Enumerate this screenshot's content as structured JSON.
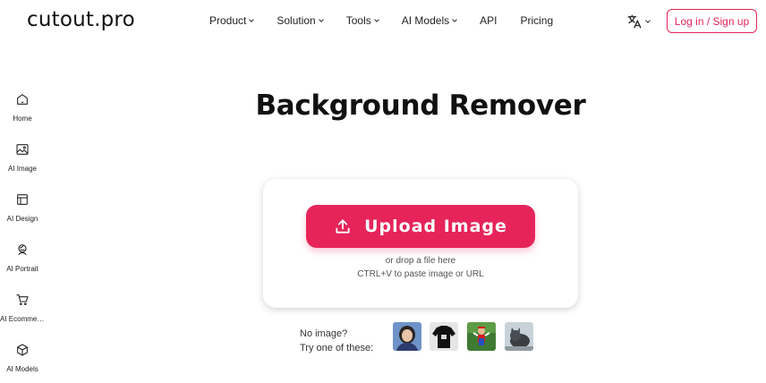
{
  "header": {
    "logo": "cutout.pro",
    "nav": [
      "Product",
      "Solution",
      "Tools",
      "AI Models",
      "API",
      "Pricing"
    ],
    "login_label": "Log in / Sign up",
    "language_icon": "translate-icon"
  },
  "sidebar": {
    "items": [
      {
        "label": "Home",
        "icon": "home-icon"
      },
      {
        "label": "AI Image",
        "icon": "image-icon"
      },
      {
        "label": "AI Design",
        "icon": "layout-icon"
      },
      {
        "label": "AI Portrait",
        "icon": "portrait-icon"
      },
      {
        "label": "AI Ecommer...",
        "icon": "cart-icon"
      },
      {
        "label": "AI Models",
        "icon": "cube-icon"
      }
    ]
  },
  "main": {
    "title": "Background Remover",
    "upload_label": "Upload Image",
    "drop_text": "or drop a file here",
    "paste_text": "CTRL+V to paste image or URL",
    "samples_line1": "No image?",
    "samples_line2": "Try one of these:"
  },
  "colors": {
    "accent": "#e6245a"
  }
}
